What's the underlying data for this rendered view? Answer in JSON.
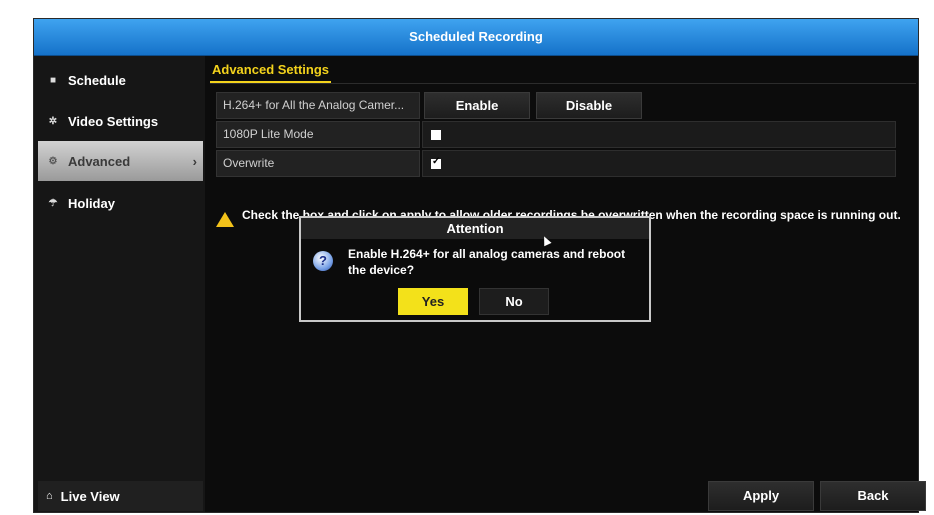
{
  "window": {
    "title": "Scheduled Recording"
  },
  "sidebar": {
    "items": [
      {
        "label": "Schedule",
        "icon": "calendar-icon"
      },
      {
        "label": "Video Settings",
        "icon": "gear-icon"
      },
      {
        "label": "Advanced",
        "icon": "advanced-icon",
        "active": true
      },
      {
        "label": "Holiday",
        "icon": "holiday-icon"
      }
    ],
    "live_view": {
      "label": "Live View",
      "icon": "home-icon"
    }
  },
  "tab": {
    "label": "Advanced Settings"
  },
  "settings": {
    "h264": {
      "label": "H.264+ for All the Analog Camer...",
      "enable_label": "Enable",
      "disable_label": "Disable"
    },
    "lite_mode": {
      "label": "1080P Lite Mode",
      "checked": false
    },
    "overwrite": {
      "label": "Overwrite",
      "checked": true
    }
  },
  "note": {
    "text": "Check the box and click on apply to allow older recordings be overwritten when the recording space is running out."
  },
  "dialog": {
    "title": "Attention",
    "message": "Enable H.264+ for all analog cameras and reboot the device?",
    "yes_label": "Yes",
    "no_label": "No"
  },
  "footer": {
    "apply_label": "Apply",
    "back_label": "Back"
  },
  "colors": {
    "titlebar": "#1f86dc",
    "accent_yellow": "#f3e11a",
    "tab_yellow": "#f3d21c"
  }
}
